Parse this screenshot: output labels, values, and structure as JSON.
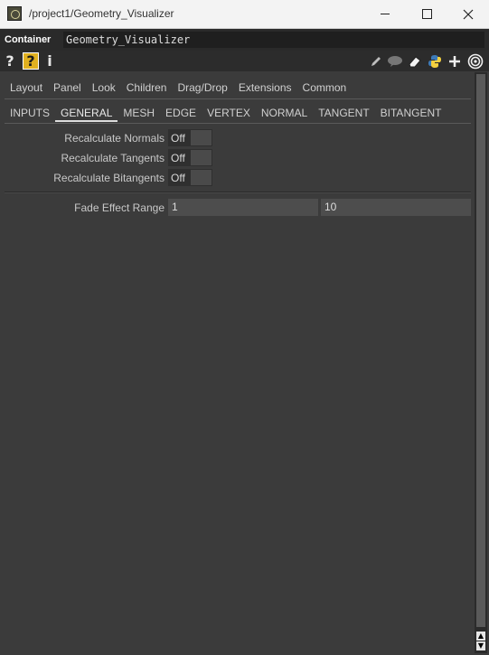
{
  "window": {
    "title": "/project1/Geometry_Visualizer"
  },
  "pathbar": {
    "op_type": "Container",
    "op_name": "Geometry_Visualizer"
  },
  "toolbar": {
    "help": "?",
    "help_box": "?",
    "info": "i",
    "icons": [
      "pencil-icon",
      "comment-icon",
      "eraser-icon",
      "python-icon",
      "plus-icon",
      "target-icon"
    ]
  },
  "page_tabs": [
    "Layout",
    "Panel",
    "Look",
    "Children",
    "Drag/Drop",
    "Extensions",
    "Common"
  ],
  "custom_tabs": {
    "items": [
      "INPUTS",
      "GENERAL",
      "MESH",
      "EDGE",
      "VERTEX",
      "NORMAL",
      "TANGENT",
      "BITANGENT"
    ],
    "active": "GENERAL"
  },
  "params": {
    "recalc_normals": {
      "label": "Recalculate Normals",
      "value": "Off"
    },
    "recalc_tangents": {
      "label": "Recalculate Tangents",
      "value": "Off"
    },
    "recalc_bitangents": {
      "label": "Recalculate Bitangents",
      "value": "Off"
    },
    "fade_range": {
      "label": "Fade Effect Range",
      "value1": "1",
      "value2": "10"
    }
  }
}
